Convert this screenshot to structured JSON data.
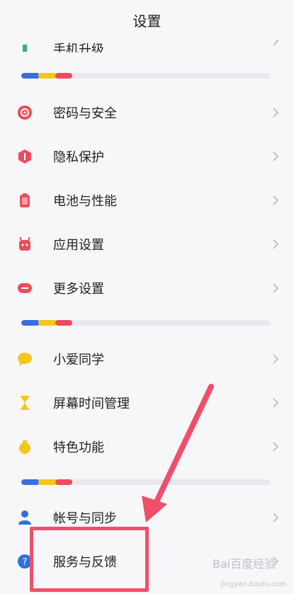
{
  "header": {
    "title": "设置"
  },
  "partial_item": {
    "label": "手机升级",
    "icon": "upgrade-icon"
  },
  "groups": [
    {
      "items": [
        {
          "label": "密码与安全",
          "icon": "password-security-icon",
          "color": "#ee4b5c"
        },
        {
          "label": "隐私保护",
          "icon": "privacy-shield-icon",
          "color": "#ee4b5c"
        },
        {
          "label": "电池与性能",
          "icon": "battery-icon",
          "color": "#ee4b5c"
        },
        {
          "label": "应用设置",
          "icon": "android-app-icon",
          "color": "#ee4b5c"
        },
        {
          "label": "更多设置",
          "icon": "more-settings-icon",
          "color": "#ee4b5c"
        }
      ]
    },
    {
      "items": [
        {
          "label": "小爱同学",
          "icon": "xiaoai-assistant-icon",
          "color": "#f5c518"
        },
        {
          "label": "屏幕时间管理",
          "icon": "hourglass-icon",
          "color": "#f5c518"
        },
        {
          "label": "特色功能",
          "icon": "special-features-icon",
          "color": "#f5c518"
        }
      ]
    },
    {
      "items": [
        {
          "label": "帐号与同步",
          "icon": "account-person-icon",
          "color": "#2f6fe0"
        },
        {
          "label": "服务与反馈",
          "icon": "help-question-icon",
          "color": "#2f6fe0"
        }
      ]
    }
  ],
  "divider_colors": [
    "#3a6fe0",
    "#f5c518",
    "#ee4b5c"
  ],
  "annotation": {
    "box_color": "#ef4f6a",
    "arrow_color": "#ef4f6a"
  },
  "watermark": {
    "brand": "Bai百度经验",
    "sub": "jingyan.baidu.com"
  }
}
